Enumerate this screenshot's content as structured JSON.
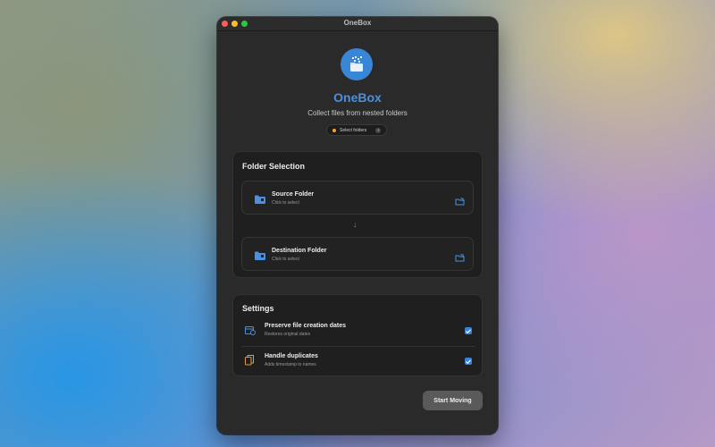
{
  "window": {
    "title": "OneBox"
  },
  "header": {
    "app_name": "OneBox",
    "subtitle": "Collect files from nested folders",
    "status_label": "Select folders",
    "help_glyph": "?",
    "accent_color": "#4a90e2",
    "status_color": "#f5a623"
  },
  "folder_selection": {
    "title": "Folder Selection",
    "source": {
      "label": "Source Folder",
      "hint": "Click to select",
      "icon": "folder-badge-icon"
    },
    "arrow": "↓",
    "destination": {
      "label": "Destination Folder",
      "hint": "Click to select",
      "icon": "folder-badge-icon"
    }
  },
  "settings": {
    "title": "Settings",
    "items": [
      {
        "label": "Preserve file creation dates",
        "hint": "Restores original dates",
        "checked": true,
        "icon": "calendar-clock-icon"
      },
      {
        "label": "Handle duplicates",
        "hint": "Adds timestamp to names",
        "checked": true,
        "icon": "duplicate-documents-icon"
      }
    ]
  },
  "actions": {
    "start_label": "Start Moving"
  }
}
